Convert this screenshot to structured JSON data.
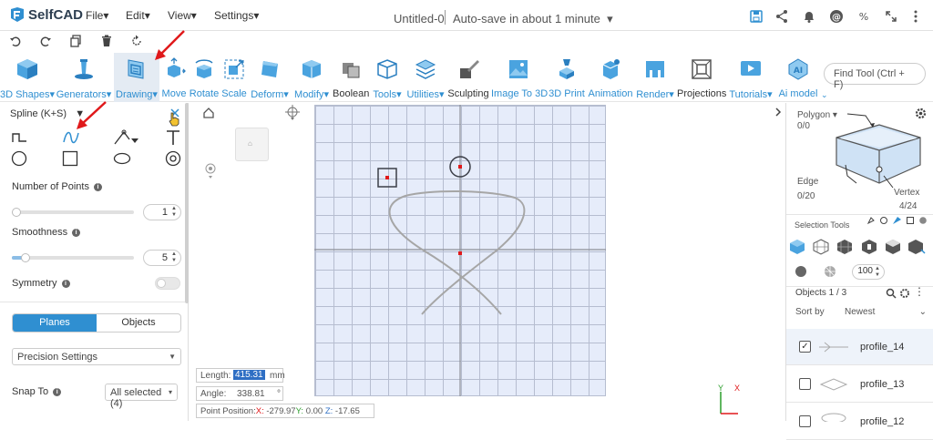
{
  "app": {
    "name": "SelfCAD"
  },
  "menu": [
    "File",
    "Edit",
    "View",
    "Settings"
  ],
  "document": {
    "name": "Untitled-0",
    "autosave": "Auto-save in about 1 minute"
  },
  "toolbar": [
    {
      "label": "3D Shapes",
      "caret": true
    },
    {
      "label": "Generators",
      "caret": true
    },
    {
      "label": "Drawing",
      "caret": true,
      "active": true
    },
    {
      "label": "Move"
    },
    {
      "label": "Rotate"
    },
    {
      "label": "Scale"
    },
    {
      "label": "Deform",
      "caret": true
    },
    {
      "label": "Modify",
      "caret": true
    },
    {
      "label": "Boolean",
      "dark": true
    },
    {
      "label": "Tools",
      "caret": true
    },
    {
      "label": "Utilities",
      "caret": true
    },
    {
      "label": "Sculpting",
      "dark": true
    },
    {
      "label": "Image To 3D"
    },
    {
      "label": "3D Print"
    },
    {
      "label": "Animation"
    },
    {
      "label": "Render",
      "caret": true
    },
    {
      "label": "Projections",
      "dark": true
    },
    {
      "label": "Tutorials",
      "caret": true
    },
    {
      "label": "Ai model"
    }
  ],
  "find_tool": {
    "placeholder": "Find Tool (Ctrl + F)"
  },
  "left_panel": {
    "title": "Spline (K+S)",
    "number_of_points": {
      "label": "Number of Points",
      "value": "1",
      "level": 0.0
    },
    "smoothness": {
      "label": "Smoothness",
      "value": "5",
      "level": 0.11
    },
    "symmetry": {
      "label": "Symmetry",
      "on": false
    },
    "tabs": [
      "Planes",
      "Objects"
    ],
    "precision": "Precision Settings",
    "snap_to": {
      "label": "Snap To",
      "value": "All selected (4)"
    }
  },
  "canvas": {
    "length": {
      "label": "Length:",
      "value": "415.31",
      "unit": "mm"
    },
    "angle": {
      "label": "Angle:",
      "value": "338.81",
      "unit": "°"
    },
    "point_position": {
      "label": "Point Position:",
      "x_label": "X:",
      "x": "-279.97",
      "y_label": "Y:",
      "y": "0.00",
      "z_label": "Z:",
      "z": "-17.65"
    },
    "axis_y": "Y",
    "axis_x": "X"
  },
  "right_panel": {
    "polygon": {
      "label": "Polygon",
      "value": "0/0"
    },
    "edge": {
      "label": "Edge",
      "value": "0/20"
    },
    "vertex": {
      "label": "Vertex",
      "value": "4/24"
    },
    "selection_tools": "Selection Tools",
    "size_value": "100",
    "objects_count": "Objects 1 / 3",
    "sort_by": {
      "label": "Sort by",
      "value": "Newest"
    },
    "objects": [
      {
        "name": "profile_14",
        "checked": true
      },
      {
        "name": "profile_13",
        "checked": false
      },
      {
        "name": "profile_12",
        "checked": false
      }
    ]
  },
  "colors": {
    "accent": "#2f8fd1",
    "grid_bg": "#e6ecfa",
    "point_red": "#e0191b"
  }
}
